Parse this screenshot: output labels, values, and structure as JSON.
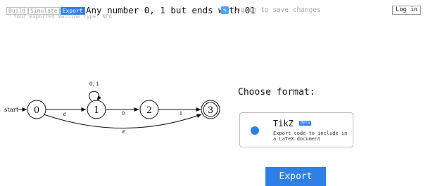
{
  "tabs": [
    {
      "label": "Build",
      "active": false
    },
    {
      "label": "Simulate",
      "active": false
    },
    {
      "label": "Export",
      "active": true
    }
  ],
  "header": {
    "title": "Any number 0, 1 but ends with 01",
    "edit_icon": "pencil-icon",
    "save_hint": "log in to save changes",
    "subtitle": "Your exported machine type: NFA",
    "login_label": "Log in"
  },
  "automaton": {
    "start_label": "start",
    "states": [
      {
        "id": "0",
        "accepting": false
      },
      {
        "id": "1",
        "accepting": false
      },
      {
        "id": "2",
        "accepting": false
      },
      {
        "id": "3",
        "accepting": true
      }
    ],
    "transitions": [
      {
        "from": "0",
        "to": "1",
        "label": "ϵ"
      },
      {
        "from": "1",
        "to": "1",
        "label": "0, 1"
      },
      {
        "from": "1",
        "to": "2",
        "label": "0"
      },
      {
        "from": "2",
        "to": "3",
        "label": "1"
      },
      {
        "from": "0",
        "to": "3",
        "label": "ϵ"
      }
    ]
  },
  "export_panel": {
    "heading": "Choose format:",
    "option": {
      "name": "TikZ",
      "badge": "Beta",
      "description": "Export code to include in a LaTeX document",
      "selected": true
    },
    "export_label": "Export"
  },
  "colors": {
    "accent": "#2f80e6",
    "muted_text": "#a8a8a8",
    "border": "#bcbcbc"
  }
}
